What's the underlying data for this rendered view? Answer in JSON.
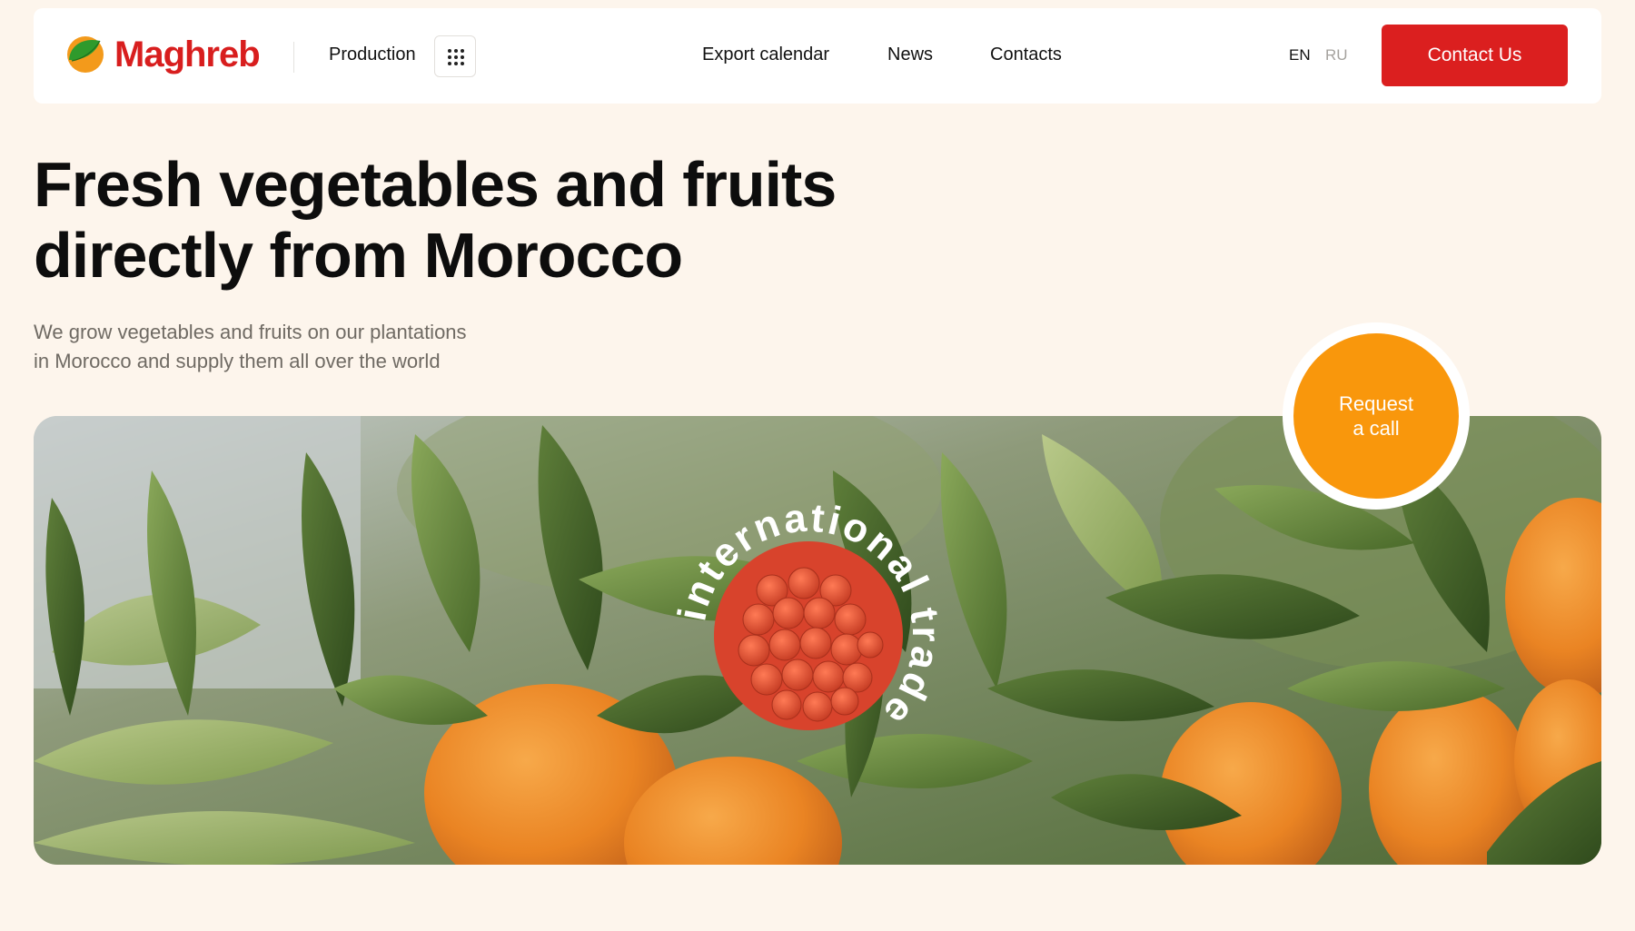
{
  "header": {
    "logo_text": "Maghreb",
    "production_label": "Production",
    "nav": [
      "Export calendar",
      "News",
      "Contacts"
    ],
    "languages": {
      "active": "EN",
      "inactive": "RU"
    },
    "contact_button": "Contact Us"
  },
  "hero": {
    "title_line1": "Fresh vegetables and fruits",
    "title_line2": "directly from Morocco",
    "subtitle_line1": "We grow vegetables and fruits on our plantations",
    "subtitle_line2": "in Morocco and supply them all over the world"
  },
  "banner": {
    "badge_text": "international trade",
    "request_call_line1": "Request",
    "request_call_line2": "a call"
  },
  "colors": {
    "page_bg": "#fdf5ec",
    "brand_red": "#d81e1e",
    "accent_orange": "#f9970c",
    "text_muted": "#6f6a63"
  },
  "icons": {
    "logo": "orange-leaf-logo-icon",
    "menu_grid": "grid-dots-icon"
  }
}
